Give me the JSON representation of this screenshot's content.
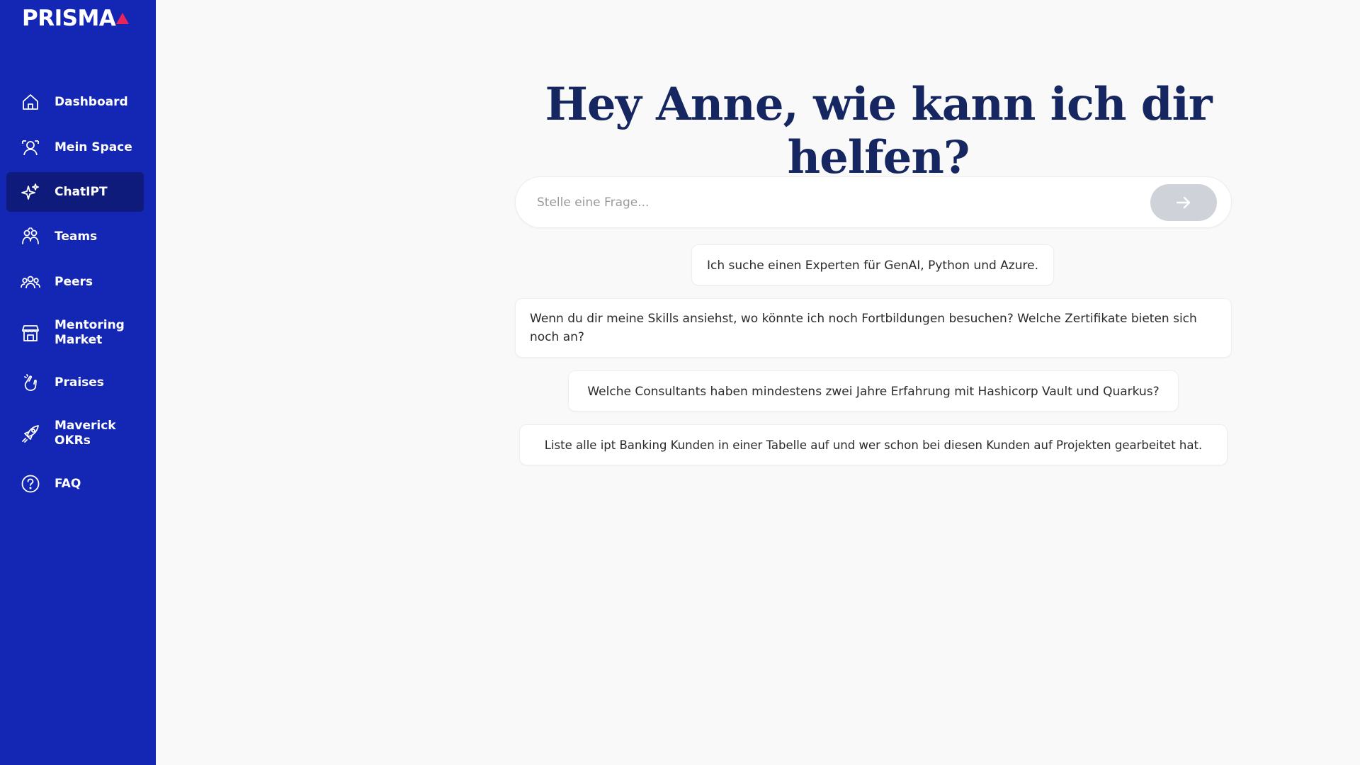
{
  "sidebar": {
    "logo": "PRISMA",
    "items": [
      {
        "label": "Dashboard",
        "icon": "home-icon"
      },
      {
        "label": "Mein Space",
        "icon": "person-space-icon"
      },
      {
        "label": "ChatIPT",
        "icon": "sparkle-icon",
        "active": true
      },
      {
        "label": "Teams",
        "icon": "teams-icon"
      },
      {
        "label": "Peers",
        "icon": "peers-icon"
      },
      {
        "label": "Mentoring Market",
        "label_line1": "Mentoring",
        "label_line2": "Market",
        "icon": "market-icon"
      },
      {
        "label": "Praises",
        "icon": "praise-icon"
      },
      {
        "label": "Maverick OKRs",
        "label_line1": "Maverick",
        "label_line2": "OKRs",
        "icon": "rocket-icon"
      },
      {
        "label": "FAQ",
        "icon": "help-circle-icon"
      }
    ]
  },
  "main": {
    "title": "Hey Anne, wie kann ich dir helfen?",
    "search": {
      "placeholder": "Stelle eine Frage...",
      "value": ""
    },
    "suggestions": [
      "Ich suche einen Experten für GenAI, Python und Azure.",
      "Wenn du dir meine Skills ansiehst, wo könnte ich noch Fortbildungen besuchen? Welche Zertifikate bieten sich noch an?",
      "Welche Consultants haben mindestens zwei Jahre Erfahrung mit Hashicorp Vault und Quarkus?",
      "Liste alle ipt Banking Kunden in einer Tabelle auf und wer schon bei diesen Kunden auf Projekten gearbeitet hat."
    ]
  },
  "colors": {
    "sidebar_bg": "#1426b4",
    "sidebar_active": "#0e1b7a",
    "title": "#152660",
    "logo_accent": "#e8245a",
    "send_button": "#cfd2d8",
    "page_bg": "#f9f9f9"
  }
}
